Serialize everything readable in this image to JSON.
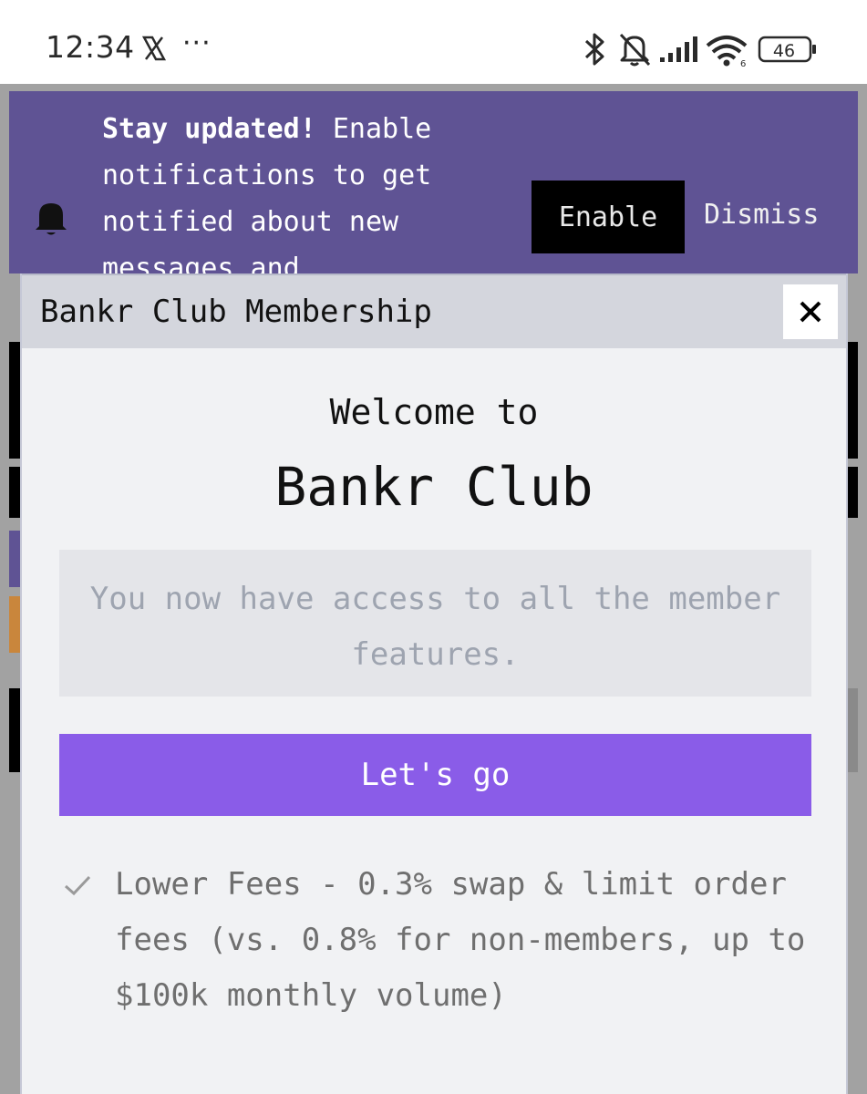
{
  "status_bar": {
    "time": "12:34",
    "dots": "···",
    "battery": "46"
  },
  "notification": {
    "headline": "Stay updated!",
    "body": "Enable notifications to get notified about new messages and",
    "enable_label": "Enable",
    "dismiss_label": "Dismiss"
  },
  "modal": {
    "title": "Bankr Club Membership",
    "close_label": "✕",
    "welcome_line1": "Welcome to",
    "welcome_line2": "Bankr Club",
    "access_text": "You now have access to all the member features.",
    "cta_label": "Let's go",
    "features": [
      "Lower Fees - 0.3% swap & limit order fees (vs. 0.8% for non-members, up to $100k monthly volume)"
    ]
  },
  "colors": {
    "banner": "#5f5394",
    "cta": "#8a5ce8",
    "backdrop": "#a2a2a2"
  }
}
